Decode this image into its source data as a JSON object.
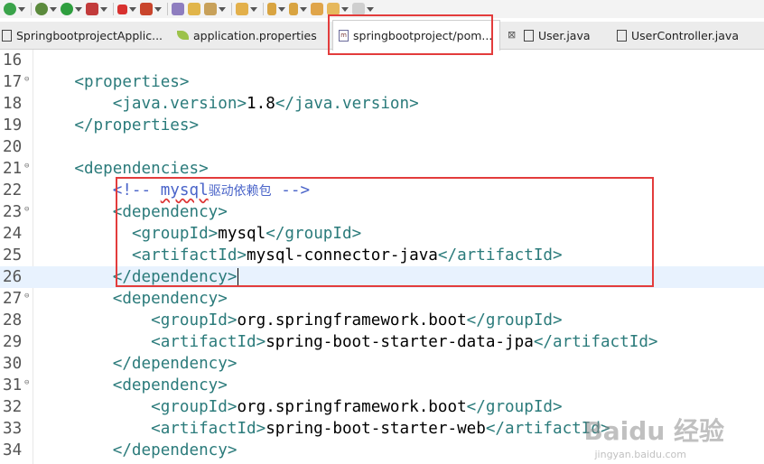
{
  "toolbar": {
    "icons": [
      "refresh-icon",
      "debug-icon",
      "run-icon",
      "run-config-icon",
      "stop-icon",
      "deploy-icon",
      "server-icon",
      "open-folder-icon",
      "tool-icon",
      "open-file-icon",
      "next-annotation-icon",
      "prev-annotation-icon",
      "last-edit-icon",
      "back-icon",
      "forward-icon"
    ]
  },
  "tabs": [
    {
      "label": "SpringbootprojectApplic...",
      "icon": "java-class-icon",
      "active": false
    },
    {
      "label": "application.properties",
      "icon": "properties-file-icon",
      "active": false
    },
    {
      "label": "springbootproject/pom...",
      "icon": "maven-pom-icon",
      "active": true,
      "close": "⊠"
    },
    {
      "label": "User.java",
      "icon": "java-file-icon",
      "active": false
    },
    {
      "label": "UserController.java",
      "icon": "java-file-icon",
      "active": false
    }
  ],
  "editor": {
    "lines": [
      {
        "n": "16",
        "fold": "",
        "indent": "",
        "parts": []
      },
      {
        "n": "17",
        "fold": "⊖",
        "indent": "    ",
        "parts": [
          {
            "c": "tag",
            "t": "<properties>"
          }
        ]
      },
      {
        "n": "18",
        "fold": "",
        "indent": "        ",
        "parts": [
          {
            "c": "tag",
            "t": "<java.version>"
          },
          {
            "c": "txt",
            "t": "1.8"
          },
          {
            "c": "tag",
            "t": "</java.version>"
          }
        ]
      },
      {
        "n": "19",
        "fold": "",
        "indent": "    ",
        "parts": [
          {
            "c": "tag",
            "t": "</properties>"
          }
        ]
      },
      {
        "n": "20",
        "fold": "",
        "indent": "",
        "parts": []
      },
      {
        "n": "21",
        "fold": "⊖",
        "indent": "    ",
        "parts": [
          {
            "c": "tag",
            "t": "<dependencies>"
          }
        ]
      },
      {
        "n": "22",
        "fold": "",
        "indent": "        ",
        "parts": [
          {
            "c": "cmt",
            "t": "<!-- "
          },
          {
            "c": "cmt squiggle",
            "t": "mysql"
          },
          {
            "c": "cmt-cn",
            "t": "驱动依赖包"
          },
          {
            "c": "cmt",
            "t": " -->"
          }
        ]
      },
      {
        "n": "23",
        "fold": "⊖",
        "indent": "        ",
        "parts": [
          {
            "c": "tag",
            "t": "<dependency>"
          }
        ]
      },
      {
        "n": "24",
        "fold": "",
        "indent": "          ",
        "parts": [
          {
            "c": "tag",
            "t": "<groupId>"
          },
          {
            "c": "txt",
            "t": "mysql"
          },
          {
            "c": "tag",
            "t": "</groupId>"
          }
        ]
      },
      {
        "n": "25",
        "fold": "",
        "indent": "          ",
        "parts": [
          {
            "c": "tag",
            "t": "<artifactId>"
          },
          {
            "c": "txt",
            "t": "mysql-connector-java"
          },
          {
            "c": "tag",
            "t": "</artifactId>"
          }
        ]
      },
      {
        "n": "26",
        "fold": "",
        "indent": "        ",
        "current": true,
        "caret": true,
        "parts": [
          {
            "c": "tag",
            "t": "</dependency>"
          }
        ]
      },
      {
        "n": "27",
        "fold": "⊖",
        "indent": "        ",
        "parts": [
          {
            "c": "tag",
            "t": "<dependency>"
          }
        ]
      },
      {
        "n": "28",
        "fold": "",
        "indent": "            ",
        "parts": [
          {
            "c": "tag",
            "t": "<groupId>"
          },
          {
            "c": "txt",
            "t": "org.springframework.boot"
          },
          {
            "c": "tag",
            "t": "</groupId>"
          }
        ]
      },
      {
        "n": "29",
        "fold": "",
        "indent": "            ",
        "parts": [
          {
            "c": "tag",
            "t": "<artifactId>"
          },
          {
            "c": "txt",
            "t": "spring-boot-starter-data-jpa"
          },
          {
            "c": "tag",
            "t": "</artifactId>"
          }
        ]
      },
      {
        "n": "30",
        "fold": "",
        "indent": "        ",
        "parts": [
          {
            "c": "tag",
            "t": "</dependency>"
          }
        ]
      },
      {
        "n": "31",
        "fold": "⊖",
        "indent": "        ",
        "parts": [
          {
            "c": "tag",
            "t": "<dependency>"
          }
        ]
      },
      {
        "n": "32",
        "fold": "",
        "indent": "            ",
        "parts": [
          {
            "c": "tag",
            "t": "<groupId>"
          },
          {
            "c": "txt",
            "t": "org.springframework.boot"
          },
          {
            "c": "tag",
            "t": "</groupId>"
          }
        ]
      },
      {
        "n": "33",
        "fold": "",
        "indent": "            ",
        "parts": [
          {
            "c": "tag",
            "t": "<artifactId>"
          },
          {
            "c": "txt",
            "t": "spring-boot-starter-web"
          },
          {
            "c": "tag",
            "t": "</artifactId>"
          }
        ]
      },
      {
        "n": "34",
        "fold": "",
        "indent": "        ",
        "parts": [
          {
            "c": "tag",
            "t": "</dependency>"
          }
        ]
      }
    ]
  },
  "watermark": {
    "main": "Baidu 经验",
    "sub": "jingyan.baidu.com"
  },
  "colors": {
    "tag": "#2b7b7b",
    "comment": "#4a64c9",
    "text": "#000000",
    "highlight": "#e33c3c",
    "current_line": "#e8f2fe"
  }
}
